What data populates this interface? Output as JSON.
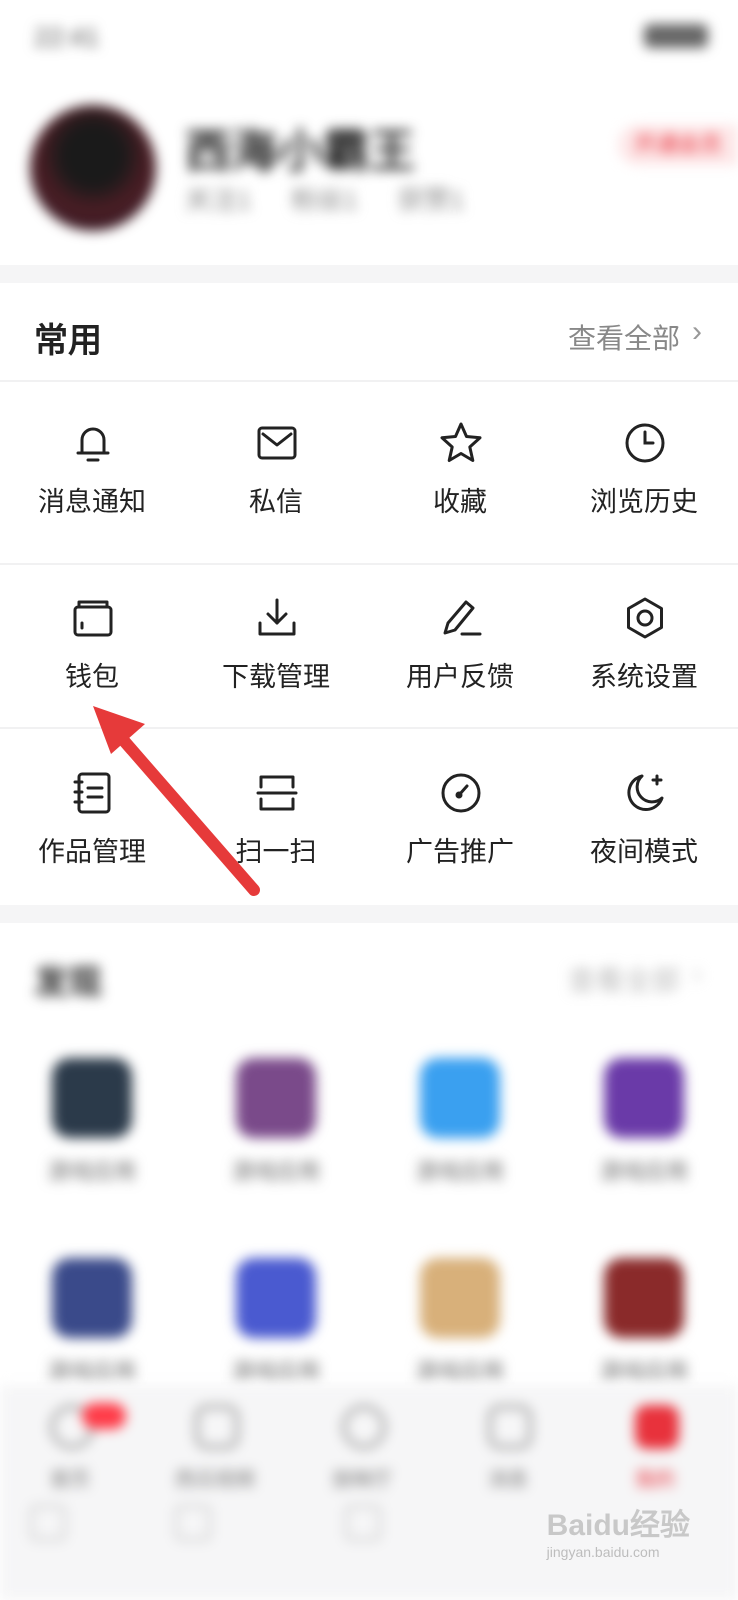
{
  "status_bar": {
    "time": "22:41"
  },
  "profile": {
    "username": "西海小霸王",
    "stats": [
      "关注1",
      "粉丝1",
      "获赞1"
    ],
    "badge": "开通会员"
  },
  "common": {
    "title": "常用",
    "view_all": "查看全部",
    "items": [
      {
        "label": "消息通知",
        "icon": "bell-icon"
      },
      {
        "label": "私信",
        "icon": "mail-icon"
      },
      {
        "label": "收藏",
        "icon": "star-icon"
      },
      {
        "label": "浏览历史",
        "icon": "clock-icon"
      },
      {
        "label": "钱包",
        "icon": "wallet-icon"
      },
      {
        "label": "下载管理",
        "icon": "download-icon"
      },
      {
        "label": "用户反馈",
        "icon": "pen-icon"
      },
      {
        "label": "系统设置",
        "icon": "gear-icon"
      },
      {
        "label": "作品管理",
        "icon": "notebook-icon"
      },
      {
        "label": "扫一扫",
        "icon": "scan-icon"
      },
      {
        "label": "广告推广",
        "icon": "gauge-icon"
      },
      {
        "label": "夜间模式",
        "icon": "moon-icon"
      }
    ]
  },
  "discover": {
    "title": "发现",
    "view_all": "查看全部",
    "apps": [
      {
        "name": "游戏应用",
        "color": "#2b3a4a"
      },
      {
        "name": "游戏应用",
        "color": "#7a4a8a"
      },
      {
        "name": "游戏应用",
        "color": "#3aa0f0"
      },
      {
        "name": "游戏应用",
        "color": "#6a3aa8"
      },
      {
        "name": "游戏应用",
        "color": "#3a4a8a"
      },
      {
        "name": "游戏应用",
        "color": "#4a5ad0"
      },
      {
        "name": "游戏应用",
        "color": "#d8b07a"
      },
      {
        "name": "游戏应用",
        "color": "#8a2a2a"
      }
    ]
  },
  "bottom_nav": {
    "items": [
      "首页",
      "西瓜视频",
      "放映厅",
      "消息",
      "我的"
    ],
    "accent": "#e8323c"
  },
  "watermark": {
    "brand": "Baidu经验",
    "url": "jingyan.baidu.com"
  }
}
